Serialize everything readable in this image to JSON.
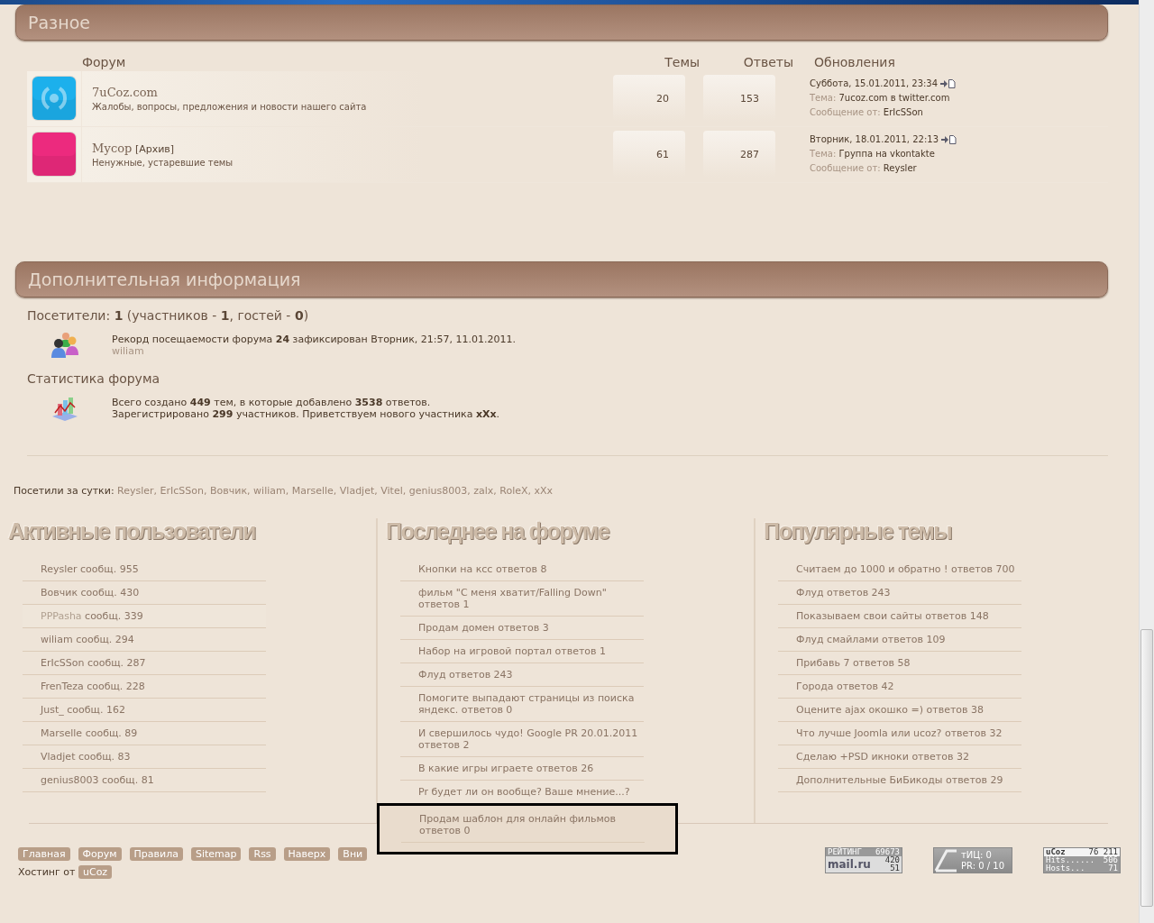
{
  "misc_section": {
    "title": "Разное",
    "columns": [
      "Форум",
      "Темы",
      "Ответы",
      "Обновления"
    ],
    "forums": [
      {
        "name": "7uCoz.com",
        "description": "Жалобы, вопросы, предложения и новости нашего сайта",
        "color": "#1cb0ec",
        "topics": "20",
        "replies": "153",
        "last_post": {
          "date": "Суббота, 15.01.2011, 23:34",
          "topic_label": "Тема:",
          "topic": "7ucoz.com в twitter.com",
          "author_label": "Сообщение от:",
          "author": "ErIcSSon"
        }
      },
      {
        "name": "Мусор",
        "tag": "[Архив]",
        "description": "Ненужные, устаревшие темы",
        "color": "#ec2a7e",
        "topics": "61",
        "replies": "287",
        "last_post": {
          "date": "Вторник, 18.01.2011, 22:13",
          "topic_label": "Тема:",
          "topic": "Группа на vkontakte",
          "author_label": "Сообщение от:",
          "author": "Reysler"
        }
      }
    ]
  },
  "info_section": {
    "title": "Дополнительная информация",
    "visitors": "Посетители: **1**  (участников - **1**, гостей - **0**)",
    "record": "Рекорд посещаемости форума **24** зафиксирован Вторник, 21:57, 11.01.2011.",
    "record_user": "wiliam",
    "stats_title": "Статистика форума",
    "stats": [
      "Всего создано **449** тем, в которые добавлено **3538** ответов.",
      "Зарегистрировано **299** участников. Приветствуем нового участника **xXx**."
    ]
  },
  "visited_today": {
    "label": "Посетили за сутки:",
    "users": "Reysler, ErIcSSon, Вовчик, wiliam, Marselle, Vladjet, Vitel, genius8003, zalx, RoleX, xXx"
  },
  "columns": [
    {
      "title": "Активные пользователи",
      "items": [
        {
          "user": "Reysler",
          "text": "сообщ. 955",
          "hovered": false
        },
        {
          "user": "Вовчик",
          "text": "сообщ. 430",
          "hovered": false
        },
        {
          "user": "PPPasha",
          "text": "сообщ. 339",
          "hovered": true
        },
        {
          "user": "wiliam",
          "text": "сообщ. 294",
          "hovered": false
        },
        {
          "user": "ErIcSSon",
          "text": "сообщ. 287",
          "hovered": false
        },
        {
          "user": "FrenTeza",
          "text": "сообщ. 228",
          "hovered": false
        },
        {
          "user": "Just_",
          "text": "сообщ. 162",
          "hovered": false
        },
        {
          "user": "Marselle",
          "text": "сообщ. 89",
          "hovered": false
        },
        {
          "user": "Vladjet",
          "text": "сообщ. 83",
          "hovered": false
        },
        {
          "user": "genius8003",
          "text": "сообщ. 81",
          "hovered": false
        }
      ]
    },
    {
      "title": "Последнее на форуме",
      "items": [
        {
          "text": "Кнопки на ксс ответов 8",
          "highlighted": false
        },
        {
          "text": "фильм \"С меня хватит/Falling Down\" ответов 1",
          "highlighted": false
        },
        {
          "text": "Продам домен ответов 3",
          "highlighted": false
        },
        {
          "text": "Набор на игровой портал ответов 1",
          "highlighted": false
        },
        {
          "text": "Флуд ответов 243",
          "highlighted": false
        },
        {
          "text": "Помогите выпадают страницы из поиска яндекс. ответов 0",
          "highlighted": false
        },
        {
          "text": "И свершилось чудо! Google PR 20.01.2011 ответов 2",
          "highlighted": false
        },
        {
          "text": "В какие игры играете ответов 26",
          "highlighted": false
        },
        {
          "text": "Pr будет ли он вообще? Ваше мнение...?",
          "highlighted": false
        },
        {
          "text": "Продам шаблон для онлайн фильмов ответов 0",
          "highlighted": true
        }
      ]
    },
    {
      "title": "Популярные темы",
      "items": [
        {
          "text": "Считаем до 1000 и обратно ! ответов 700"
        },
        {
          "text": "Флуд ответов 243"
        },
        {
          "text": "Показываем свои сайты ответов 148"
        },
        {
          "text": "Флуд смайлами ответов 109"
        },
        {
          "text": "Прибавь 7 ответов 58"
        },
        {
          "text": "Города ответов 42"
        },
        {
          "text": "Оцените ajax окошко =) ответов 38"
        },
        {
          "text": "Что лучше Joomla или ucoz? ответов 32"
        },
        {
          "text": "Сделаю +PSD икноки ответов 32"
        },
        {
          "text": "Дополнительные БиБикоды ответов 29"
        }
      ]
    }
  ],
  "footer": {
    "nav": [
      "Главная",
      "Форум",
      "Правила",
      "Sitemap",
      "Rss",
      "Наверх",
      "Вни"
    ],
    "hosting_label": "Хостинг от",
    "hosting_link": "uCoz",
    "counters": [
      {
        "kind": "mailru",
        "label": "РЕЙТИНГ",
        "logo": "mail.ru",
        "values": [
          "69673",
          "420",
          "51"
        ]
      },
      {
        "kind": "pr",
        "lines": [
          "тИЦ: 0",
          "PR: 0 / 10"
        ]
      },
      {
        "kind": "ucoz",
        "logo": "uCoz",
        "label_1": "Hits......",
        "label_2": "Hosts...",
        "values": [
          "76 211",
          "506",
          "71"
        ]
      }
    ]
  }
}
